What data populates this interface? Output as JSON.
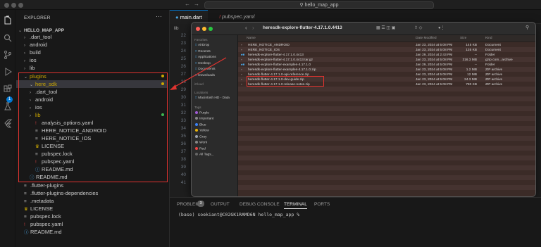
{
  "window": {
    "search_text": "hello_map_app"
  },
  "explorer": {
    "header": "EXPLORER",
    "project": "HELLO_MAP_APP",
    "items": [
      {
        "label": ".dart_tool",
        "kind": "folder"
      },
      {
        "label": "android",
        "kind": "folder"
      },
      {
        "label": "build",
        "kind": "folder"
      },
      {
        "label": "ios",
        "kind": "folder"
      },
      {
        "label": "lib",
        "kind": "folder"
      },
      {
        "label": "plugins",
        "kind": "folder-open"
      },
      {
        "label": "here_sdk",
        "kind": "folder-open"
      },
      {
        "label": ".dart_tool",
        "kind": "folder"
      },
      {
        "label": "android",
        "kind": "folder"
      },
      {
        "label": "ios",
        "kind": "folder"
      },
      {
        "label": "lib",
        "kind": "folder"
      },
      {
        "label": "analysis_options.yaml",
        "kind": "file"
      },
      {
        "label": "HERE_NOTICE_ANDROID",
        "kind": "file"
      },
      {
        "label": "HERE_NOTICE_IOS",
        "kind": "file"
      },
      {
        "label": "LICENSE",
        "kind": "file"
      },
      {
        "label": "pubspec.lock",
        "kind": "file"
      },
      {
        "label": "pubspec.yaml",
        "kind": "file"
      },
      {
        "label": "README.md",
        "kind": "file"
      },
      {
        "label": "README.md",
        "kind": "file"
      },
      {
        "label": ".flutter-plugins",
        "kind": "file"
      },
      {
        "label": ".flutter-plugins-dependencies",
        "kind": "file"
      },
      {
        "label": ".metadata",
        "kind": "file"
      },
      {
        "label": "LICENSE",
        "kind": "file"
      },
      {
        "label": "pubspec.lock",
        "kind": "file"
      },
      {
        "label": "pubspec.yaml",
        "kind": "file"
      },
      {
        "label": "README.md",
        "kind": "file"
      }
    ]
  },
  "editor": {
    "tabs": [
      {
        "label": "main.dart"
      },
      {
        "label": "pubspec.yaml"
      }
    ],
    "breadcrumb": "lib",
    "line_numbers": [
      "22",
      "23",
      "24",
      "25",
      "26",
      "27",
      "28",
      "29",
      "30",
      "31",
      "32",
      "33",
      "34",
      "35",
      "36",
      "37",
      "38",
      "39",
      "40",
      "41"
    ]
  },
  "finder": {
    "title": "heresdk-explore-flutter-4.17.1.0.4413",
    "columns": {
      "name": "Name",
      "date": "Date Modified",
      "size": "Size",
      "kind": "Kind"
    },
    "sidebar": {
      "favorites_label": "Favorites",
      "favorites": [
        "AirDrop",
        "Recents",
        "Applications",
        "Desktop",
        "Documents",
        "Downloads"
      ],
      "icloud_label": "iCloud",
      "locations_label": "Locations",
      "locations": [
        "Macintosh HD - Data"
      ],
      "tags_label": "Tags",
      "tags": [
        {
          "name": "Purple",
          "color": "#a05cd6"
        },
        {
          "name": "Important",
          "color": "#888888"
        },
        {
          "name": "Blue",
          "color": "#3b82f6"
        },
        {
          "name": "Yellow",
          "color": "#eab308"
        },
        {
          "name": "Gray",
          "color": "#9ca3af"
        },
        {
          "name": "Work",
          "color": "#888888"
        },
        {
          "name": "Red",
          "color": "#ef4444"
        },
        {
          "name": "All Tags...",
          "color": ""
        }
      ]
    },
    "files": [
      {
        "name": "HERE_NOTICE_ANDROID",
        "date": "Jan 23, 2024 at 5:08 PM",
        "size": "145 KB",
        "kind": "Document"
      },
      {
        "name": "HERE_NOTICE_IOS",
        "date": "Jan 23, 2024 at 5:08 PM",
        "size": "135 KB",
        "kind": "Document"
      },
      {
        "name": "heresdk-explore-flutter-4.17.1.0.4413",
        "date": "Jan 29, 2024 at 2:43 PM",
        "size": "--",
        "kind": "Folder"
      },
      {
        "name": "heresdk-explore-flutter-4.17.1.0.4413.tar.gz",
        "date": "Jan 23, 2024 at 5:08 PM",
        "size": "316.3 MB",
        "kind": "gzip com...archive"
      },
      {
        "name": "heresdk-explore-flutter-examples-4.17.1.0",
        "date": "Jan 29, 2024 at 5:08 PM",
        "size": "--",
        "kind": "Folder"
      },
      {
        "name": "heresdk-explore-flutter-examples-4.17.1.0.zip",
        "date": "Jan 23, 2024 at 5:08 PM",
        "size": "1.2 MB",
        "kind": "ZIP archive"
      },
      {
        "name": "heresdk-flutter-4.17.1.0-api-reference.zip",
        "date": "Jan 23, 2024 at 5:08 PM",
        "size": "12 MB",
        "kind": "ZIP archive"
      },
      {
        "name": "heresdk-flutter-4.17.1.0-dev-guide.zip",
        "date": "Jan 23, 2024 at 5:08 PM",
        "size": "24.3 MB",
        "kind": "ZIP archive"
      },
      {
        "name": "heresdk-flutter-4.17.1.0-release-notes.zip",
        "date": "Jan 23, 2024 at 5:08 PM",
        "size": "780 KB",
        "kind": "ZIP archive"
      }
    ]
  },
  "panel": {
    "tabs": [
      "PROBLEMS",
      "OUTPUT",
      "DEBUG CONSOLE",
      "TERMINAL",
      "PORTS"
    ],
    "problems_count": "3",
    "terminal_line": "(base) soekiant@C02GK1RAMD6N hello_map_app %"
  },
  "colors": {
    "highlight": "#e0332f",
    "accent": "#0078d4",
    "modified": "#cca700"
  }
}
